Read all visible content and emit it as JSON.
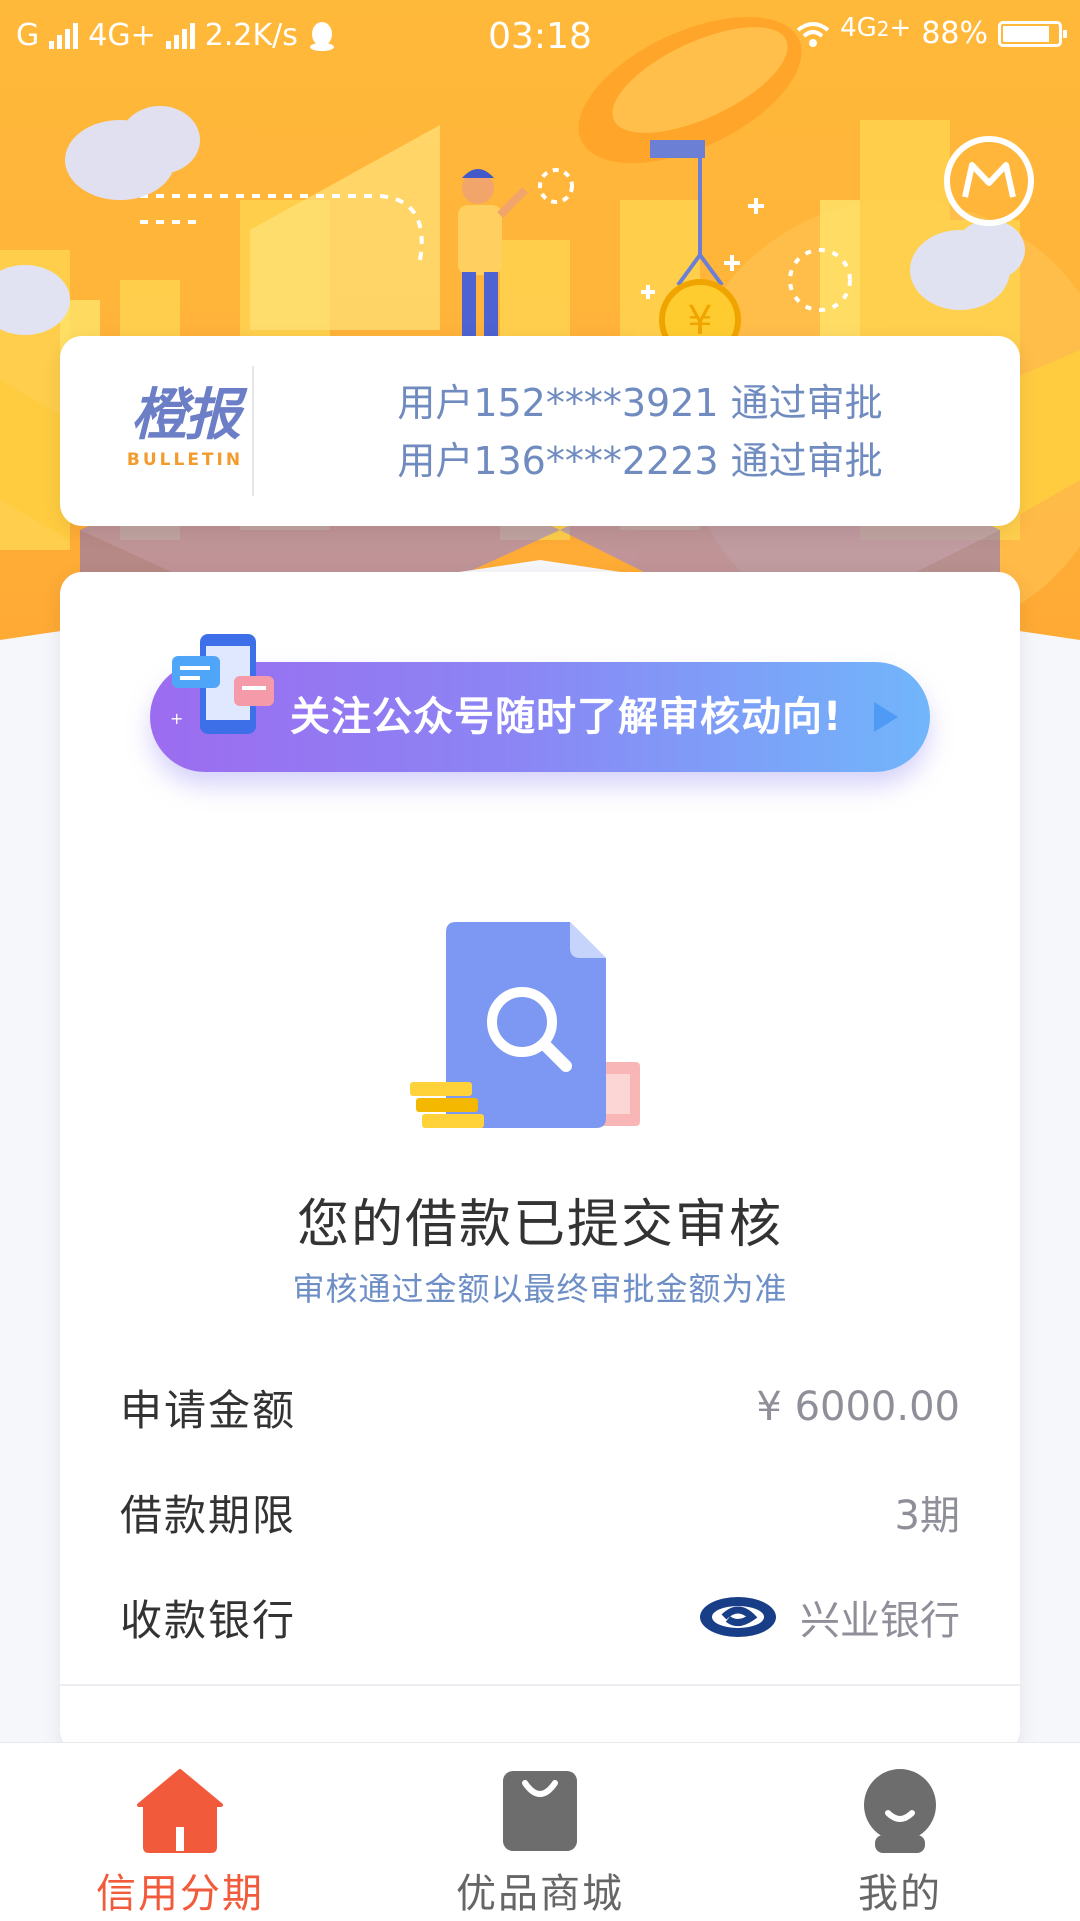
{
  "status_bar": {
    "carrier_left": "G",
    "network_label": "4G+",
    "speed": "2.2K/s",
    "time": "03:18",
    "network_right": "4G",
    "sim_index": "2",
    "network_right_plus": "+",
    "battery_percent": "88%",
    "battery_level": 0.88,
    "icons": [
      "signal-icon",
      "qq-icon",
      "wifi-icon",
      "battery-icon"
    ]
  },
  "header": {
    "message_icon": "mail-circle-icon"
  },
  "bulletin": {
    "logo_cn": "橙报",
    "logo_en": "BULLETIN",
    "items": [
      "用户152****3921 通过审批",
      "用户136****2223 通过审批"
    ]
  },
  "banner": {
    "text": "关注公众号随时了解审核动向!",
    "icon": "phone-chat-icon"
  },
  "status": {
    "icon": "document-search-icon",
    "title": "您的借款已提交审核",
    "subtitle": "审核通过金额以最终审批金额为准"
  },
  "details": [
    {
      "label": "申请金额",
      "value": "¥ 6000.00"
    },
    {
      "label": "借款期限",
      "value": "3期"
    },
    {
      "label": "收款银行",
      "value": "兴业银行",
      "icon": "cib-bank-logo-icon"
    }
  ],
  "tabs": [
    {
      "label": "信用分期",
      "icon": "home-icon",
      "active": true
    },
    {
      "label": "优品商城",
      "icon": "shopping-bag-icon",
      "active": false
    },
    {
      "label": "我的",
      "icon": "user-face-icon",
      "active": false
    }
  ],
  "colors": {
    "accent": "#f25a3c",
    "header": "#ffb33a",
    "link_blue": "#6e8ec6"
  }
}
